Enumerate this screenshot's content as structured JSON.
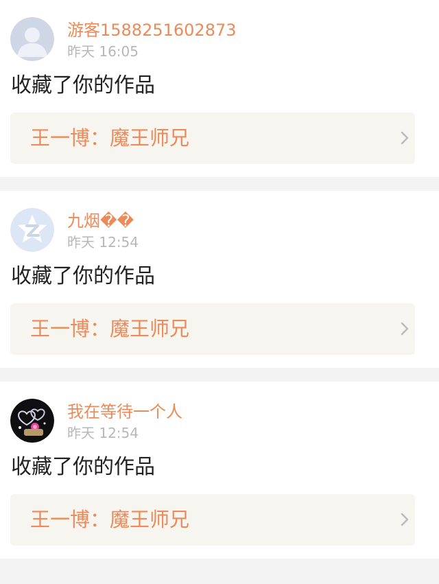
{
  "notifications": [
    {
      "avatar_icon": "default-user-avatar",
      "username": "游客1588251602873",
      "time": "昨天 16:05",
      "action": "收藏了你的作品",
      "work_title": "王一博：魔王师兄"
    },
    {
      "avatar_icon": "qzone-star-avatar",
      "username": "九烟��",
      "time": "昨天 12:54",
      "action": "收藏了你的作品",
      "work_title": "王一博：魔王师兄"
    },
    {
      "avatar_icon": "hearts-photo-avatar",
      "username": "我在等待一个人",
      "time": "昨天 12:54",
      "action": "收藏了你的作品",
      "work_title": "王一博：魔王师兄"
    }
  ],
  "colors": {
    "accent": "#ec8a59",
    "timestamp": "#b7b7b7",
    "link_background": "#f6f5ef",
    "page_background": "#f3f3f3"
  }
}
